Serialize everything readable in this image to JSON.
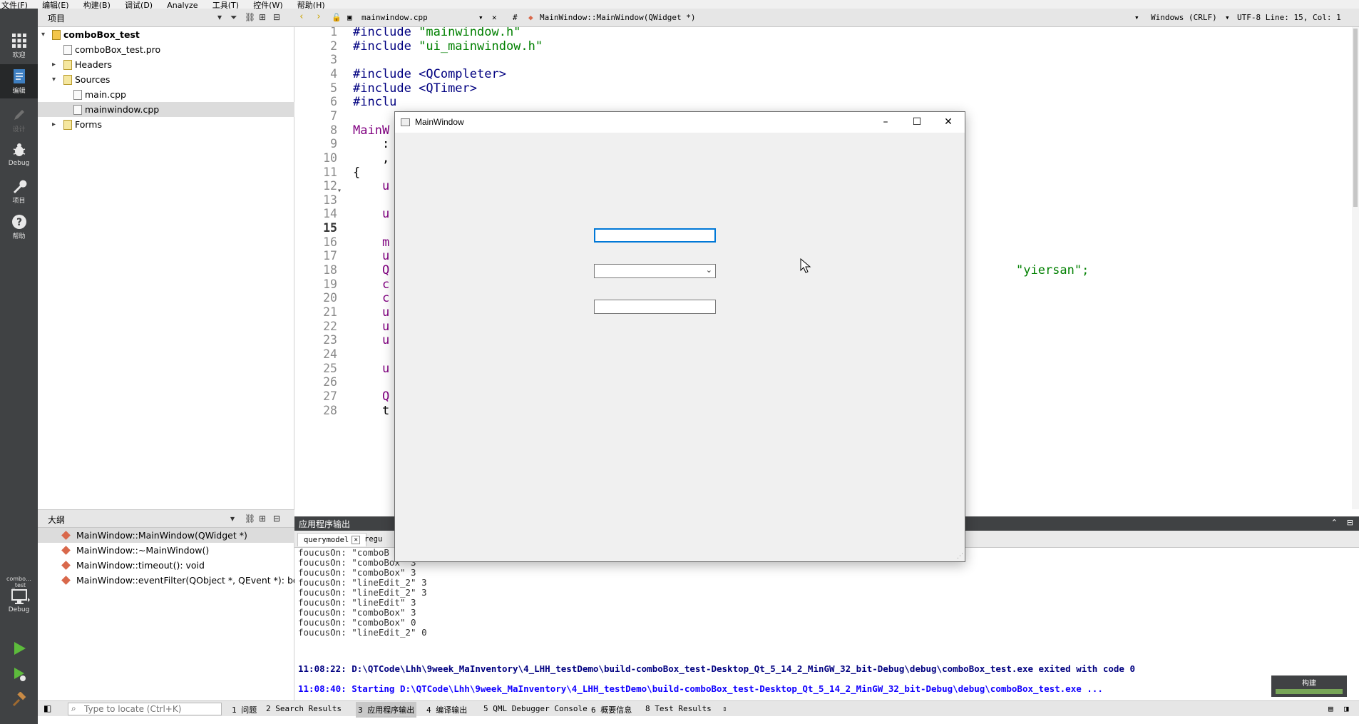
{
  "menubar": {
    "items": [
      "文件(F)",
      "编辑(E)",
      "构建(B)",
      "调试(D)",
      "Analyze",
      "工具(T)",
      "控件(W)",
      "帮助(H)"
    ]
  },
  "modebar": {
    "items": [
      {
        "label": "欢迎",
        "icon": "grid-icon"
      },
      {
        "label": "编辑",
        "icon": "document-icon"
      },
      {
        "label": "设计",
        "icon": "pencil-icon"
      },
      {
        "label": "Debug",
        "icon": "bug-icon"
      },
      {
        "label": "项目",
        "icon": "wrench-icon"
      },
      {
        "label": "帮助",
        "icon": "help-icon"
      }
    ],
    "kit_label": "combo…_test",
    "kit_mode": "Debug"
  },
  "project": {
    "title": "项目",
    "tree": [
      {
        "text": "comboBox_test",
        "level": 0
      },
      {
        "text": "comboBox_test.pro",
        "level": 1
      },
      {
        "text": "Headers",
        "level": 1
      },
      {
        "text": "Sources",
        "level": 1
      },
      {
        "text": "main.cpp",
        "level": 2
      },
      {
        "text": "mainwindow.cpp",
        "level": 2
      },
      {
        "text": "Forms",
        "level": 1
      }
    ]
  },
  "outline": {
    "title": "大纲",
    "items": [
      "MainWindow::MainWindow(QWidget *)",
      "MainWindow::~MainWindow()",
      "MainWindow::timeout(): void",
      "MainWindow::eventFilter(QObject *, QEvent *): bool"
    ]
  },
  "editor_bar": {
    "file": "mainwindow.cpp",
    "hash": "#",
    "symbol": "MainWindow::MainWindow(QWidget *)",
    "line_ending": "Windows (CRLF)",
    "position": "UTF-8 Line: 15, Col: 1"
  },
  "editor": {
    "current_line": 15,
    "lines": [
      "#include \"mainwindow.h\"",
      "#include \"ui_mainwindow.h\"",
      "",
      "#include <QCompleter>",
      "#include <QTimer>",
      "#inclu",
      "",
      "MainW",
      "    :",
      "    ,",
      "{",
      "    u",
      "",
      "    u",
      "",
      "    m",
      "    u",
      "    Q",
      "    c",
      "    c",
      "    u",
      "    u",
      "    u",
      "",
      "    u",
      "",
      "    Q",
      "    t"
    ],
    "line16_tail": "\"yiersan\";"
  },
  "output": {
    "title": "应用程序输出",
    "tabs": [
      "querymodel",
      "regu"
    ],
    "lines": [
      "foucusOn: \"comboB",
      "foucusOn: \"comboBox\" 3",
      "foucusOn: \"comboBox\" 3",
      "foucusOn: \"lineEdit_2\" 3",
      "foucusOn: \"lineEdit_2\" 3",
      "foucusOn: \"lineEdit\" 3",
      "foucusOn: \"comboBox\" 3",
      "foucusOn: \"comboBox\" 0",
      "foucusOn: \"lineEdit_2\" 0"
    ],
    "exit_line": "11:08:22: D:\\QTCode\\Lhh\\9week_MaInventory\\4_LHH_testDemo\\build-comboBox_test-Desktop_Qt_5_14_2_MinGW_32_bit-Debug\\debug\\comboBox_test.exe exited with code 0",
    "start_line": "11:08:40: Starting D:\\QTCode\\Lhh\\9week_MaInventory\\4_LHH_testDemo\\build-comboBox_test-Desktop_Qt_5_14_2_MinGW_32_bit-Debug\\debug\\comboBox_test.exe ..."
  },
  "build": {
    "label": "构建",
    "progress": 1.0
  },
  "statusbar": {
    "locate_placeholder": "Type to locate (Ctrl+K)",
    "tabs": [
      "1 问题",
      "2 Search Results",
      "3 应用程序输出",
      "4 编译输出",
      "5 QML Debugger Console",
      "6 概要信息",
      "8 Test Results"
    ],
    "active_tab": 2
  },
  "appwindow": {
    "title": "MainWindow",
    "minimize": "–",
    "maximize": "☐",
    "close": "✕"
  },
  "colors": {
    "modebar": "#404244",
    "selection": "#dcdcdc",
    "focus": "#0078d7",
    "progress": "#78a658"
  }
}
